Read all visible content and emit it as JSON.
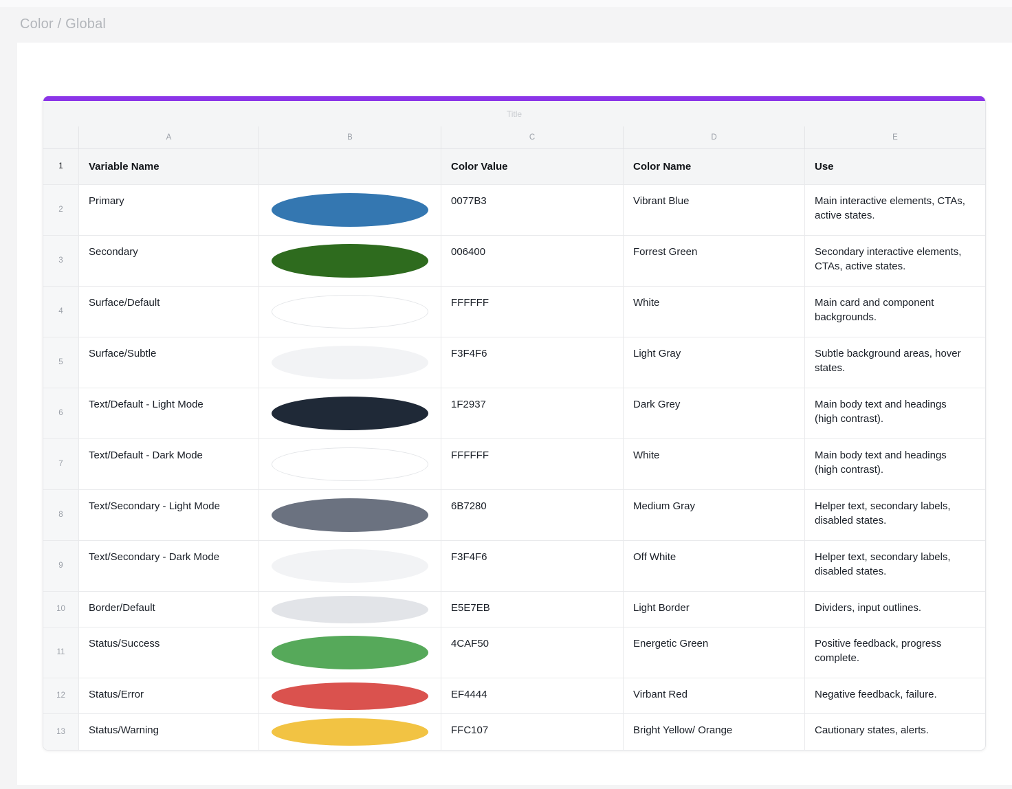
{
  "page": {
    "breadcrumb": "Color / Global"
  },
  "colors": {
    "accent_bar": "#8B35E8",
    "page_background": "#F4F4F5",
    "canvas_background": "#FFFFFF",
    "header_background": "#F4F5F6",
    "grid_line": "#E9EAEC"
  },
  "table": {
    "title_placeholder": "Title",
    "column_letters": [
      "A",
      "B",
      "C",
      "D",
      "E"
    ],
    "header": {
      "number": "1",
      "cells": [
        "Variable Name",
        "",
        "Color Value",
        "Color Name",
        "Use"
      ]
    },
    "rows": [
      {
        "number": "2",
        "variable": "Primary",
        "swatch_color": "#3477B1",
        "swatch_border": "",
        "value": "0077B3",
        "name": "Vibrant Blue",
        "use": "Main interactive elements, CTAs, active states.",
        "short": false
      },
      {
        "number": "3",
        "variable": "Secondary",
        "swatch_color": "#2E6B1E",
        "swatch_border": "",
        "value": "006400",
        "name": "Forrest Green",
        "use": "Secondary interactive elements, CTAs, active states.",
        "short": false
      },
      {
        "number": "4",
        "variable": "Surface/Default",
        "swatch_color": "#FFFFFF",
        "swatch_border": "#E3E5E8",
        "value": "FFFFFF",
        "name": "White",
        "use": "Main card and component backgrounds.",
        "short": false
      },
      {
        "number": "5",
        "variable": "Surface/Subtle",
        "swatch_color": "#F2F3F5",
        "swatch_border": "",
        "value": "F3F4F6",
        "name": "Light Gray",
        "use": "Subtle background areas, hover states.",
        "short": false
      },
      {
        "number": "6",
        "variable": "Text/Default - Light Mode",
        "swatch_color": "#1F2937",
        "swatch_border": "",
        "value": "1F2937",
        "name": "Dark Grey",
        "use": "Main body text and headings (high contrast).",
        "short": false
      },
      {
        "number": "7",
        "variable": "Text/Default - Dark Mode",
        "swatch_color": "#FFFFFF",
        "swatch_border": "#E3E5E8",
        "value": "FFFFFF",
        "name": "White",
        "use": "Main body text and headings (high contrast).",
        "short": false
      },
      {
        "number": "8",
        "variable": "Text/Secondary - Light Mode",
        "swatch_color": "#6B7280",
        "swatch_border": "",
        "value": "6B7280",
        "name": "Medium Gray",
        "use": "Helper text, secondary labels, disabled states.",
        "short": false
      },
      {
        "number": "9",
        "variable": "Text/Secondary - Dark Mode",
        "swatch_color": "#F2F3F5",
        "swatch_border": "",
        "value": "F3F4F6",
        "name": "Off White",
        "use": "Helper text, secondary labels, disabled states.",
        "short": false
      },
      {
        "number": "10",
        "variable": "Border/Default",
        "swatch_color": "#E2E4E8",
        "swatch_border": "",
        "value": "E5E7EB",
        "name": "Light Border",
        "use": "Dividers, input outlines.",
        "short": true
      },
      {
        "number": "11",
        "variable": "Status/Success",
        "swatch_color": "#56A95A",
        "swatch_border": "",
        "value": "4CAF50",
        "name": "Energetic Green",
        "use": "Positive feedback, progress complete.",
        "short": false
      },
      {
        "number": "12",
        "variable": "Status/Error",
        "swatch_color": "#DA524E",
        "swatch_border": "",
        "value": "EF4444",
        "name": "Virbant Red",
        "use": "Negative feedback, failure.",
        "short": true
      },
      {
        "number": "13",
        "variable": "Status/Warning",
        "swatch_color": "#F2C343",
        "swatch_border": "",
        "value": "FFC107",
        "name": "Bright Yellow/ Orange",
        "use": "Cautionary states, alerts.",
        "short": true
      }
    ]
  }
}
